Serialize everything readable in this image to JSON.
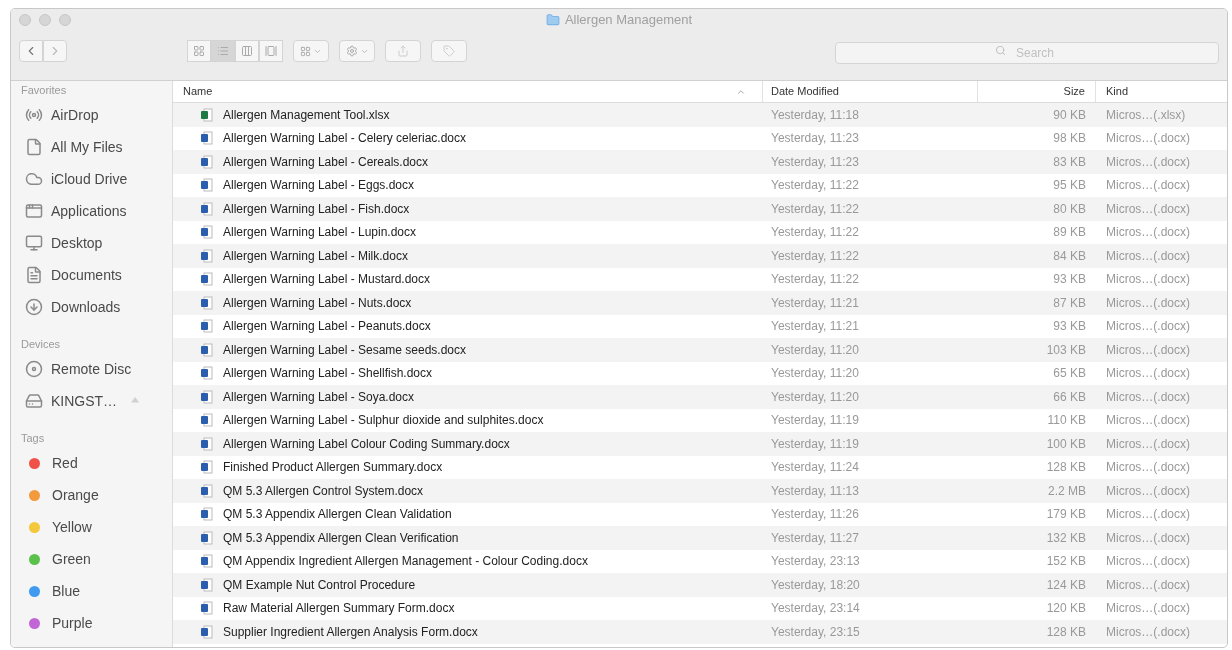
{
  "window": {
    "title": "Allergen Management"
  },
  "toolbar": {
    "view_modes": [
      {
        "selected": false
      },
      {
        "selected": true
      },
      {
        "selected": false
      },
      {
        "selected": false
      }
    ],
    "search": {
      "placeholder": "Search"
    }
  },
  "sidebar": {
    "sections": [
      {
        "title": "Favorites",
        "items": [
          {
            "label": "AirDrop"
          },
          {
            "label": "All My Files"
          },
          {
            "label": "iCloud Drive"
          },
          {
            "label": "Applications"
          },
          {
            "label": "Desktop"
          },
          {
            "label": "Documents"
          },
          {
            "label": "Downloads"
          }
        ]
      },
      {
        "title": "Devices",
        "items": [
          {
            "label": "Remote Disc"
          },
          {
            "label": "KINGST…",
            "ejectable": true
          }
        ]
      },
      {
        "title": "Tags",
        "items": [
          {
            "label": "Red",
            "color": "#f0524a"
          },
          {
            "label": "Orange",
            "color": "#f39a3c"
          },
          {
            "label": "Yellow",
            "color": "#f3c93b"
          },
          {
            "label": "Green",
            "color": "#5ac24a"
          },
          {
            "label": "Blue",
            "color": "#3e9bf0"
          },
          {
            "label": "Purple",
            "color": "#c266d6"
          }
        ]
      }
    ]
  },
  "table": {
    "columns": [
      "Name",
      "Date Modified",
      "Size",
      "Kind"
    ],
    "sort_ascending": true,
    "rows": [
      {
        "kind": "xlsx",
        "name": "Allergen Management Tool.xlsx",
        "date": "Yesterday, 11:18",
        "size": "90 KB",
        "type": "Micros…(.xlsx)"
      },
      {
        "kind": "docx",
        "name": "Allergen Warning Label - Celery celeriac.docx",
        "date": "Yesterday, 11:23",
        "size": "98 KB",
        "type": "Micros…(.docx)"
      },
      {
        "kind": "docx",
        "name": "Allergen Warning Label - Cereals.docx",
        "date": "Yesterday, 11:23",
        "size": "83 KB",
        "type": "Micros…(.docx)"
      },
      {
        "kind": "docx",
        "name": "Allergen Warning Label - Eggs.docx",
        "date": "Yesterday, 11:22",
        "size": "95 KB",
        "type": "Micros…(.docx)"
      },
      {
        "kind": "docx",
        "name": "Allergen Warning Label - Fish.docx",
        "date": "Yesterday, 11:22",
        "size": "80 KB",
        "type": "Micros…(.docx)"
      },
      {
        "kind": "docx",
        "name": "Allergen Warning Label - Lupin.docx",
        "date": "Yesterday, 11:22",
        "size": "89 KB",
        "type": "Micros…(.docx)"
      },
      {
        "kind": "docx",
        "name": "Allergen Warning Label - Milk.docx",
        "date": "Yesterday, 11:22",
        "size": "84 KB",
        "type": "Micros…(.docx)"
      },
      {
        "kind": "docx",
        "name": "Allergen Warning Label - Mustard.docx",
        "date": "Yesterday, 11:22",
        "size": "93 KB",
        "type": "Micros…(.docx)"
      },
      {
        "kind": "docx",
        "name": "Allergen Warning Label - Nuts.docx",
        "date": "Yesterday, 11:21",
        "size": "87 KB",
        "type": "Micros…(.docx)"
      },
      {
        "kind": "docx",
        "name": "Allergen Warning Label - Peanuts.docx",
        "date": "Yesterday, 11:21",
        "size": "93 KB",
        "type": "Micros…(.docx)"
      },
      {
        "kind": "docx",
        "name": "Allergen Warning Label - Sesame seeds.docx",
        "date": "Yesterday, 11:20",
        "size": "103 KB",
        "type": "Micros…(.docx)"
      },
      {
        "kind": "docx",
        "name": "Allergen Warning Label - Shellfish.docx",
        "date": "Yesterday, 11:20",
        "size": "65 KB",
        "type": "Micros…(.docx)"
      },
      {
        "kind": "docx",
        "name": "Allergen Warning Label - Soya.docx",
        "date": "Yesterday, 11:20",
        "size": "66 KB",
        "type": "Micros…(.docx)"
      },
      {
        "kind": "docx",
        "name": "Allergen Warning Label - Sulphur dioxide and sulphites.docx",
        "date": "Yesterday, 11:19",
        "size": "110 KB",
        "type": "Micros…(.docx)"
      },
      {
        "kind": "docx",
        "name": "Allergen Warning Label Colour Coding Summary.docx",
        "date": "Yesterday, 11:19",
        "size": "100 KB",
        "type": "Micros…(.docx)"
      },
      {
        "kind": "docx",
        "name": "Finished Product Allergen Summary.docx",
        "date": "Yesterday, 11:24",
        "size": "128 KB",
        "type": "Micros…(.docx)"
      },
      {
        "kind": "docx",
        "name": "QM 5.3 Allergen Control System.docx",
        "date": "Yesterday, 11:13",
        "size": "2.2 MB",
        "type": "Micros…(.docx)"
      },
      {
        "kind": "docx",
        "name": "QM 5.3 Appendix Allergen Clean Validation",
        "date": "Yesterday, 11:26",
        "size": "179 KB",
        "type": "Micros…(.docx)"
      },
      {
        "kind": "docx",
        "name": "QM 5.3 Appendix Allergen Clean Verification",
        "date": "Yesterday, 11:27",
        "size": "132 KB",
        "type": "Micros…(.docx)"
      },
      {
        "kind": "docx",
        "name": "QM Appendix Ingredient Allergen Management - Colour Coding.docx",
        "date": "Yesterday, 23:13",
        "size": "152 KB",
        "type": "Micros…(.docx)"
      },
      {
        "kind": "docx",
        "name": "QM Example Nut Control Procedure",
        "date": "Yesterday, 18:20",
        "size": "124 KB",
        "type": "Micros…(.docx)"
      },
      {
        "kind": "docx",
        "name": "Raw Material Allergen Summary Form.docx",
        "date": "Yesterday, 23:14",
        "size": "120 KB",
        "type": "Micros…(.docx)"
      },
      {
        "kind": "docx",
        "name": "Supplier Ingredient Allergen Analysis Form.docx",
        "date": "Yesterday, 23:15",
        "size": "128 KB",
        "type": "Micros…(.docx)"
      }
    ]
  }
}
